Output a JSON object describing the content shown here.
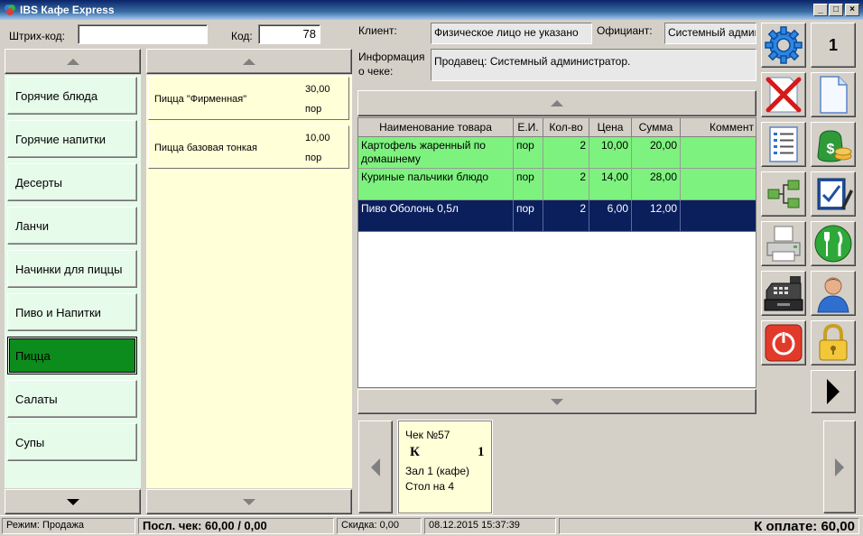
{
  "window": {
    "title": "IBS Кафе Express"
  },
  "header": {
    "barcode_label": "Штрих-код:",
    "barcode_value": "",
    "code_label": "Код:",
    "code_value": "78",
    "client_label": "Клиент:",
    "client_value": "Физическое лицо не указано",
    "waiter_label": "Официант:",
    "waiter_value": "Системный администратор",
    "info_label_1": "Информация",
    "info_label_2": "о чеке:",
    "info_value": "Продавец: Системный администратор."
  },
  "categories": [
    {
      "label": "Горячие блюда"
    },
    {
      "label": "Горячие напитки"
    },
    {
      "label": "Десерты"
    },
    {
      "label": "Ланчи"
    },
    {
      "label": "Начинки для пиццы"
    },
    {
      "label": "Пиво и Напитки"
    },
    {
      "label": "Пицца"
    },
    {
      "label": "Салаты"
    },
    {
      "label": "Супы"
    }
  ],
  "active_category": "Пицца",
  "products": [
    {
      "name": "Пицца \"Фирменная\"",
      "price": "30,00",
      "unit": "пор"
    },
    {
      "name": "Пицца базовая тонкая",
      "price": "10,00",
      "unit": "пор"
    }
  ],
  "order_table": {
    "columns": [
      "Наименование товара",
      "Е.И.",
      "Кол-во",
      "Цена",
      "Сумма",
      "Коммент"
    ],
    "rows": [
      {
        "name": "Картофель жаренный по домашнему",
        "unit": "пор",
        "qty": "2",
        "price": "10,00",
        "sum": "20,00",
        "comment": ""
      },
      {
        "name": "Куриные пальчики блюдо",
        "unit": "пор",
        "qty": "2",
        "price": "14,00",
        "sum": "28,00",
        "comment": ""
      },
      {
        "name": "Пиво Оболонь 0,5л",
        "unit": "пор",
        "qty": "2",
        "price": "6,00",
        "sum": "12,00",
        "comment": ""
      }
    ],
    "selected_row": 2
  },
  "check_card": {
    "number": "Чек №57",
    "letter": "К",
    "count": "1",
    "hall": "Зал 1 (кафе)",
    "table": "Стол на 4"
  },
  "toolbar": {
    "page_number": "1",
    "icons": [
      "settings-icon",
      "page-icon",
      "cancel-icon",
      "money-icon",
      "receipt-list-icon",
      "edit-icon",
      "tree-icon",
      "fork-knife-icon",
      "printer-icon",
      "user-icon",
      "cash-register-icon",
      "lock-icon",
      "power-icon",
      "next-arrow-icon"
    ]
  },
  "status_bar": {
    "mode": "Режим: Продажа",
    "last_check": "Посл. чек: 60,00 / 0,00",
    "discount": "Скидка: 0,00",
    "datetime": "08.12.2015 15:37:39",
    "to_pay": "К оплате: 60,00"
  },
  "colors": {
    "category_bg": "#e6fbea",
    "category_active": "#0c8c1c",
    "product_bg": "#ffffd8",
    "row_green": "#7ef27e",
    "row_selected": "#0a1f5c"
  }
}
